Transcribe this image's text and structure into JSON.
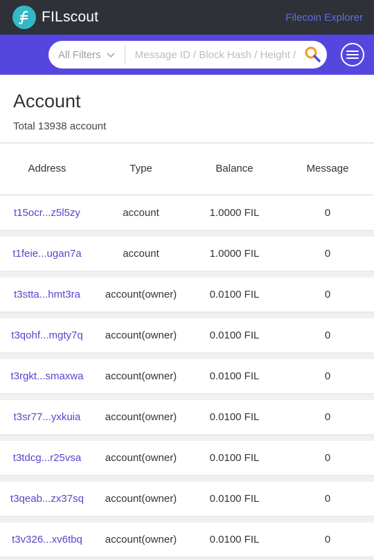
{
  "brand": {
    "name": "FILscout"
  },
  "header": {
    "explorer_link": "Filecoin Explorer"
  },
  "search": {
    "filter_label": "All Filters",
    "placeholder": "Message ID / Block Hash / Height / Address"
  },
  "page": {
    "title": "Account",
    "subtitle": "Total 13938 account"
  },
  "table": {
    "columns": [
      "Address",
      "Type",
      "Balance",
      "Message"
    ],
    "rows": [
      {
        "address": "t15ocr...z5l5zy",
        "type": "account",
        "balance": "1.0000 FIL",
        "message": "0"
      },
      {
        "address": "t1feie...ugan7a",
        "type": "account",
        "balance": "1.0000 FIL",
        "message": "0"
      },
      {
        "address": "t3stta...hmt3ra",
        "type": "account(owner)",
        "balance": "0.0100 FIL",
        "message": "0"
      },
      {
        "address": "t3qohf...mgty7q",
        "type": "account(owner)",
        "balance": "0.0100 FIL",
        "message": "0"
      },
      {
        "address": "t3rgkt...smaxwa",
        "type": "account(owner)",
        "balance": "0.0100 FIL",
        "message": "0"
      },
      {
        "address": "t3sr77...yxkuia",
        "type": "account(owner)",
        "balance": "0.0100 FIL",
        "message": "0"
      },
      {
        "address": "t3tdcg...r25vsa",
        "type": "account(owner)",
        "balance": "0.0100 FIL",
        "message": "0"
      },
      {
        "address": "t3qeab...zx37sq",
        "type": "account(owner)",
        "balance": "0.0100 FIL",
        "message": "0"
      },
      {
        "address": "t3v326...xv6tbq",
        "type": "account(owner)",
        "balance": "0.0100 FIL",
        "message": "0"
      }
    ]
  },
  "colors": {
    "topbar": "#2e3138",
    "accent": "#5646e0",
    "logo": "#35b8c6",
    "link": "#5646c9",
    "search_icon": "#f39a1e"
  },
  "icons": {
    "logo": "filecoin-logo-icon",
    "filter_chevron": "chevron-down-icon",
    "search": "search-icon",
    "menu": "hamburger-menu-icon"
  }
}
